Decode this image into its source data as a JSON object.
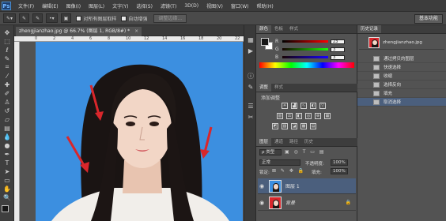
{
  "app": {
    "logo": "Ps"
  },
  "menu": [
    "文件(F)",
    "编辑(E)",
    "图像(I)",
    "图层(L)",
    "文字(Y)",
    "选择(S)",
    "滤镜(T)",
    "3D(D)",
    "视图(V)",
    "窗口(W)",
    "帮助(H)"
  ],
  "options": {
    "sample_all_label": "对所有图层取样",
    "auto_enhance_label": "自动增强",
    "refine_edge_label": "调整边缘...",
    "workspace_label": "基本功能"
  },
  "document": {
    "tab_title": "zhengjianzhao.jpg @ 66.7% (图层 1, RGB/8#) *",
    "ruler_ticks": [
      "0",
      "2",
      "4",
      "6",
      "8",
      "10",
      "12",
      "14",
      "16",
      "18",
      "20",
      "22"
    ]
  },
  "color_panel": {
    "tabs": [
      "颜色",
      "色板",
      "样式"
    ],
    "r_label": "R",
    "g_label": "G",
    "b_label": "B",
    "r_value": "23",
    "g_value": "3",
    "b_value": "3"
  },
  "adjust_panel": {
    "tabs": [
      "调整",
      "样式"
    ],
    "title": "添加调整"
  },
  "layers_panel": {
    "tabs": [
      "图层",
      "通道",
      "路径",
      "历史"
    ],
    "kind_label": "ρ 类型",
    "blend_mode": "正常",
    "opacity_label": "不透明度:",
    "opacity_value": "100%",
    "lock_label": "锁定:",
    "fill_label": "填充:",
    "fill_value": "100%",
    "layers": [
      {
        "name": "图层 1",
        "selected": true
      },
      {
        "name": "背景",
        "selected": false
      }
    ]
  },
  "history_panel": {
    "tabs": [
      "历史记录"
    ],
    "snapshot": "zhengjianzhao.jpg",
    "items": [
      "通过拷贝的图层",
      "快速选择",
      "收缩",
      "选择反向",
      "填充",
      "取消选择"
    ],
    "active_index": 5
  },
  "colors": {
    "photo_bg": "#3c8fe0",
    "selected_row": "#4b5f7d"
  }
}
